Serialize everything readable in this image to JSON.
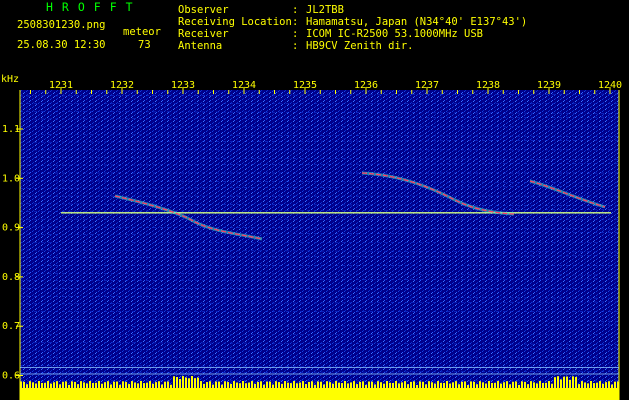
{
  "header": {
    "logo": "HROFFT",
    "filename": "2508301230.png",
    "datetime": "25.08.30 12:30",
    "meteor_label": "meteor",
    "meteor_count": "73",
    "fields": [
      {
        "label": "Observer",
        "value": "JL2TBB"
      },
      {
        "label": "Receiving Location",
        "value": "Hamamatsu, Japan (N34°40' E137°43')"
      },
      {
        "label": "Receiver",
        "value": "ICOM IC-R2500 53.1000MHz USB"
      },
      {
        "label": "Antenna",
        "value": "HB9CV Zenith dir."
      }
    ]
  },
  "spectrogram": {
    "unit_label": "kHz",
    "time_ticks": [
      "1231",
      "1232",
      "1233",
      "1234",
      "1235",
      "1236",
      "1237",
      "1238",
      "1239",
      "1240"
    ],
    "freq_ticks": [
      "1.1",
      "1.0",
      "0.9",
      "0.8",
      "0.7",
      "0.6"
    ],
    "colors": {
      "background": "#00008c",
      "ticks": "#ffff00",
      "level_bar": "#ffff00",
      "echo": "#ff3c64",
      "line": "#d2ff82"
    }
  }
}
